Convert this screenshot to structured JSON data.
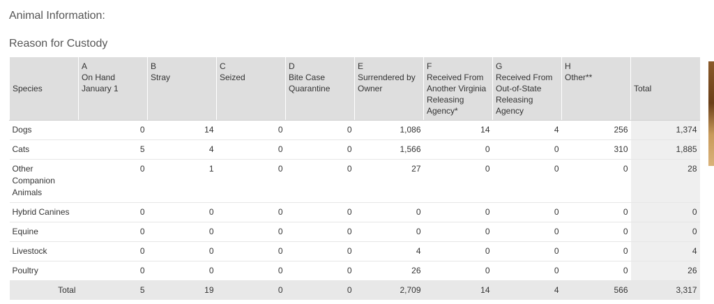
{
  "page": {
    "title": "Animal Information:",
    "subtitle": "Reason for Custody"
  },
  "table": {
    "headers": [
      {
        "letter": "",
        "label": "Species"
      },
      {
        "letter": "A",
        "label": "On Hand January 1"
      },
      {
        "letter": "B",
        "label": "Stray"
      },
      {
        "letter": "C",
        "label": "Seized"
      },
      {
        "letter": "D",
        "label": "Bite Case Quarantine"
      },
      {
        "letter": "E",
        "label": "Surrendered by Owner"
      },
      {
        "letter": "F",
        "label": "Received From Another Virginia Releasing Agency*"
      },
      {
        "letter": "G",
        "label": "Received From Out-of-State Releasing Agency"
      },
      {
        "letter": "H",
        "label": "Other**"
      },
      {
        "letter": "",
        "label": "Total"
      }
    ],
    "rows": [
      {
        "species": "Dogs",
        "values": [
          "0",
          "14",
          "0",
          "0",
          "1,086",
          "14",
          "4",
          "256"
        ],
        "total": "1,374"
      },
      {
        "species": "Cats",
        "values": [
          "5",
          "4",
          "0",
          "0",
          "1,566",
          "0",
          "0",
          "310"
        ],
        "total": "1,885"
      },
      {
        "species": "Other Companion Animals",
        "values": [
          "0",
          "1",
          "0",
          "0",
          "27",
          "0",
          "0",
          "0"
        ],
        "total": "28"
      },
      {
        "species": "Hybrid Canines",
        "values": [
          "0",
          "0",
          "0",
          "0",
          "0",
          "0",
          "0",
          "0"
        ],
        "total": "0"
      },
      {
        "species": "Equine",
        "values": [
          "0",
          "0",
          "0",
          "0",
          "0",
          "0",
          "0",
          "0"
        ],
        "total": "0"
      },
      {
        "species": "Livestock",
        "values": [
          "0",
          "0",
          "0",
          "0",
          "4",
          "0",
          "0",
          "0"
        ],
        "total": "4"
      },
      {
        "species": "Poultry",
        "values": [
          "0",
          "0",
          "0",
          "0",
          "26",
          "0",
          "0",
          "0"
        ],
        "total": "26"
      }
    ],
    "footer": {
      "label": "Total",
      "values": [
        "5",
        "19",
        "0",
        "0",
        "2,709",
        "14",
        "4",
        "566"
      ],
      "total": "3,317"
    }
  }
}
